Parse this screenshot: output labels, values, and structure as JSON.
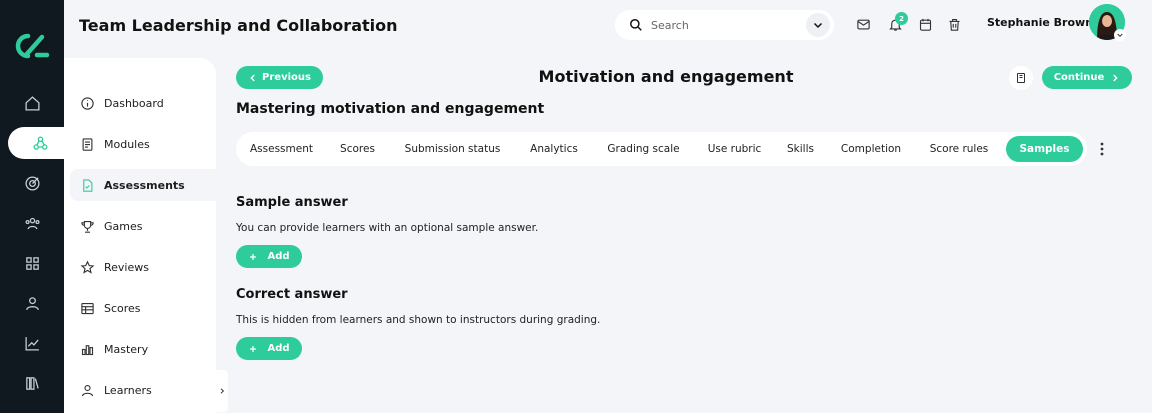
{
  "app": {
    "title": "Team Leadership and Collaboration"
  },
  "rail": {
    "items": [
      {
        "icon": "home-icon"
      },
      {
        "icon": "nodes-icon"
      },
      {
        "icon": "target-icon"
      },
      {
        "icon": "users-icon"
      },
      {
        "icon": "grid-icon"
      },
      {
        "icon": "person-icon"
      },
      {
        "icon": "chart-icon"
      },
      {
        "icon": "library-icon"
      }
    ]
  },
  "sidebar": {
    "items": [
      {
        "label": "Dashboard",
        "icon": "info-icon"
      },
      {
        "label": "Modules",
        "icon": "document-icon"
      },
      {
        "label": "Assessments",
        "icon": "file-check-icon"
      },
      {
        "label": "Games",
        "icon": "trophy-icon"
      },
      {
        "label": "Reviews",
        "icon": "star-icon"
      },
      {
        "label": "Scores",
        "icon": "table-icon"
      },
      {
        "label": "Mastery",
        "icon": "bars-icon"
      },
      {
        "label": "Learners",
        "icon": "learner-icon"
      }
    ]
  },
  "header": {
    "search_placeholder": "Search",
    "notification_count": "2",
    "user_name": "Stephanie Brown"
  },
  "nav": {
    "previous_label": "Previous",
    "continue_label": "Continue",
    "page_title": "Motivation and engagement"
  },
  "section_title": "Mastering motivation and engagement",
  "tabs": [
    {
      "label": "Assessment"
    },
    {
      "label": "Scores"
    },
    {
      "label": "Submission status"
    },
    {
      "label": "Analytics"
    },
    {
      "label": "Grading scale"
    },
    {
      "label": "Use rubric"
    },
    {
      "label": "Skills"
    },
    {
      "label": "Completion"
    },
    {
      "label": "Score rules"
    },
    {
      "label": "Samples"
    }
  ],
  "sample": {
    "title": "Sample answer",
    "description": "You can provide learners with an optional sample answer.",
    "add_label": "Add"
  },
  "correct": {
    "title": "Correct answer",
    "description": "This is hidden from learners and shown to instructors during grading.",
    "add_label": "Add"
  },
  "colors": {
    "accent": "#2ecc9a",
    "rail": "#101820",
    "background": "#f4f5f8"
  }
}
